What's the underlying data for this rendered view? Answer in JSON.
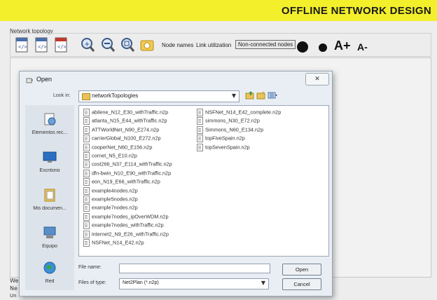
{
  "app": {
    "title": "OFFLINE NETWORK DESIGN",
    "toolbar_label": "Network topology",
    "node_names_label": "Node names",
    "link_utilization_label": "Link utilization",
    "non_connected_button": "Non-connected nodes",
    "font_increase": "A+",
    "font_decrease": "A-",
    "status_labels": [
      "We",
      "Ne",
      "Un"
    ]
  },
  "dialog": {
    "title": "Open",
    "close_glyph": "✕",
    "look_in_label": "Look in:",
    "look_in_value": "networkTopologies",
    "places": [
      "Elementos rec...",
      "Escritorio",
      "Mis documen...",
      "Equipo",
      "Red"
    ],
    "files_col1": [
      "abilene_N12_E30_withTraffic.n2p",
      "atlanta_N15_E44_withTraffic.n2p",
      "ATTWorldNet_N90_E274.n2p",
      "carrierGlobal_N100_E272.n2p",
      "cooperNet_N60_E156.n2p",
      "cornet_N5_E10.n2p",
      "cost266_N37_E114_withTraffic.n2p",
      "dfn-bwin_N10_E90_withTraffic.n2p",
      "eon_N19_E66_withTraffic.n2p",
      "example4nodes.n2p",
      "example5nodes.n2p",
      "example7nodes.n2p",
      "example7nodes_ipOverWDM.n2p",
      "example7nodes_withTraffic.n2p",
      "internet2_N9_E26_withTraffic.n2p",
      "NSFNet_N14_E42.n2p"
    ],
    "files_col2": [
      "NSFNet_N14_E42_complete.n2p",
      "simmons_N30_E72.n2p",
      "Simmons_N60_E134.n2p",
      "topFiveSpain.n2p",
      "topSevenSpain.n2p"
    ],
    "file_name_label": "File name:",
    "file_name_value": "",
    "file_type_label": "Files of type:",
    "file_type_value": "Net2Plan (*.n2p)",
    "open_button": "Open",
    "cancel_button": "Cancel"
  }
}
